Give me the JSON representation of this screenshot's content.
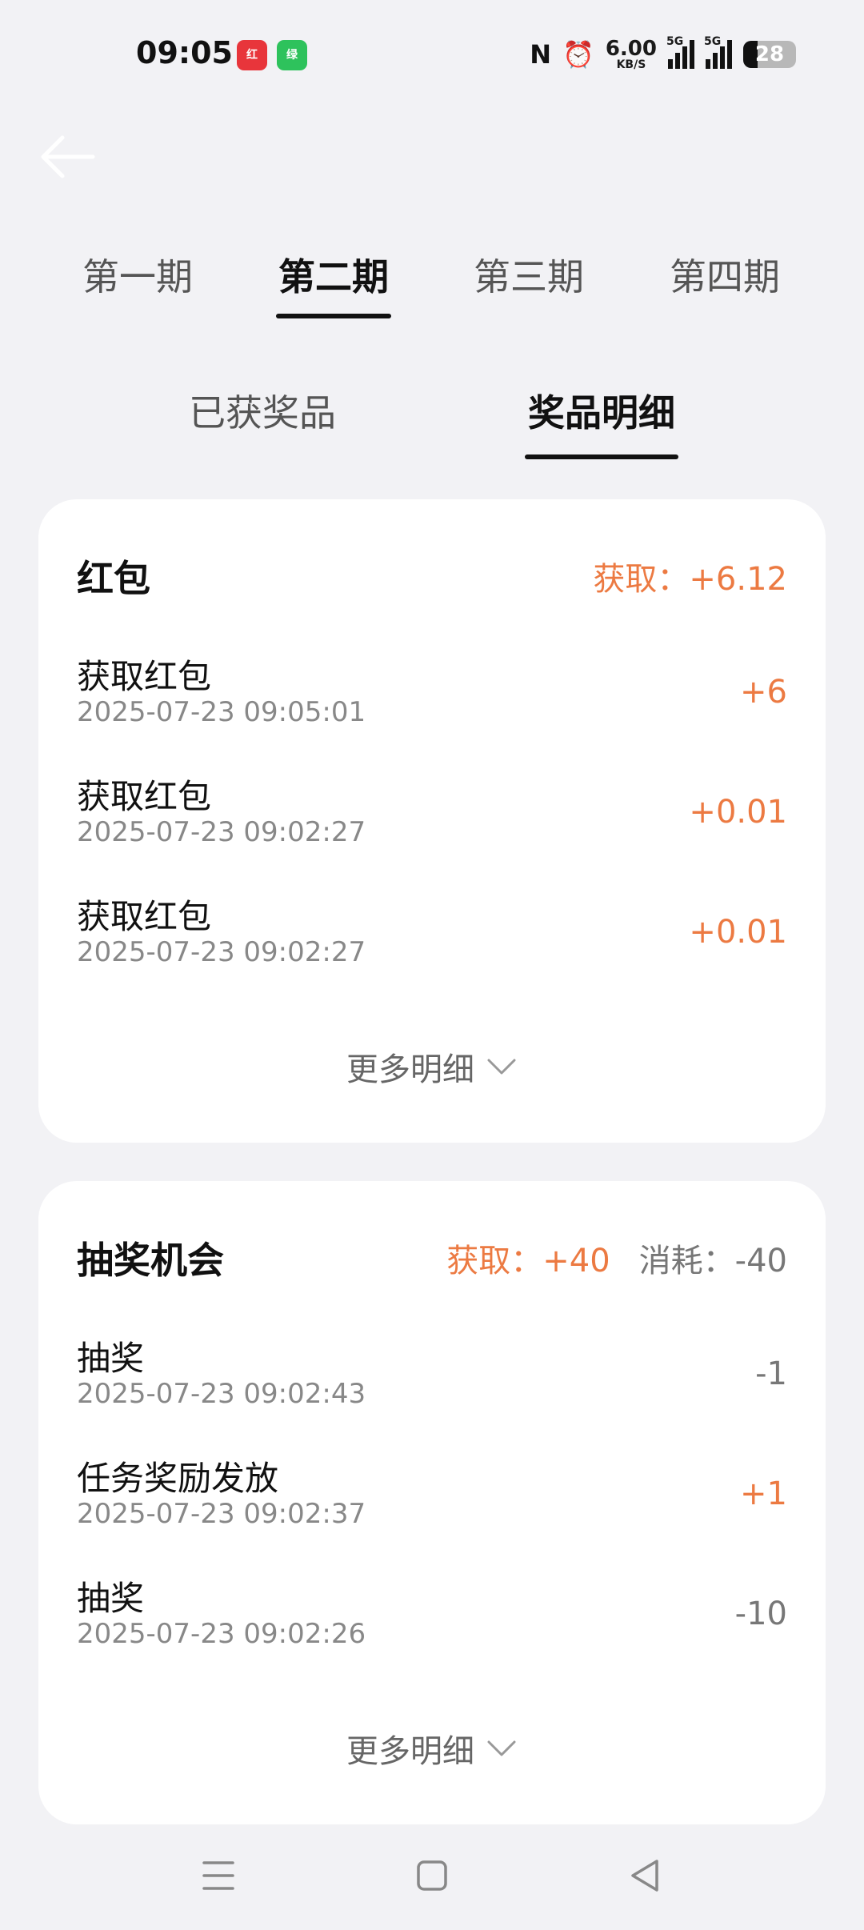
{
  "status_bar": {
    "time": "09:05",
    "app_icon_1": "红",
    "app_icon_2": "绿",
    "nfc_icon": "N",
    "alarm_icon": "⏰",
    "net_speed_value": "6.00",
    "net_speed_unit": "KB/S",
    "signal1_tag": "5G",
    "signal2_tag": "5G",
    "battery": "28",
    "battery_level": 0.28
  },
  "period_tabs": [
    {
      "label": "第一期",
      "active": false
    },
    {
      "label": "第二期",
      "active": true
    },
    {
      "label": "第三期",
      "active": false
    },
    {
      "label": "第四期",
      "active": false
    }
  ],
  "sub_tabs": [
    {
      "label": "已获奖品",
      "active": false
    },
    {
      "label": "奖品明细",
      "active": true
    }
  ],
  "red_packet": {
    "title": "红包",
    "gain": "获取：+6.12",
    "records": [
      {
        "name": "获取红包",
        "time": "2025-07-23 09:05:01",
        "amount": "+6"
      },
      {
        "name": "获取红包",
        "time": "2025-07-23 09:02:27",
        "amount": "+0.01"
      },
      {
        "name": "获取红包",
        "time": "2025-07-23 09:02:27",
        "amount": "+0.01"
      }
    ],
    "more": "更多明细"
  },
  "lottery": {
    "title": "抽奖机会",
    "gain": "获取：+40",
    "cost": "消耗：-40",
    "records": [
      {
        "name": "抽奖",
        "time": "2025-07-23 09:02:43",
        "amount": "-1"
      },
      {
        "name": "任务奖励发放",
        "time": "2025-07-23 09:02:37",
        "amount": "+1"
      },
      {
        "name": "抽奖",
        "time": "2025-07-23 09:02:26",
        "amount": "-10"
      }
    ],
    "more": "更多明细"
  },
  "colors": {
    "accent": "#ec7a42",
    "muted": "#777777",
    "background": "#f2f2f5"
  }
}
